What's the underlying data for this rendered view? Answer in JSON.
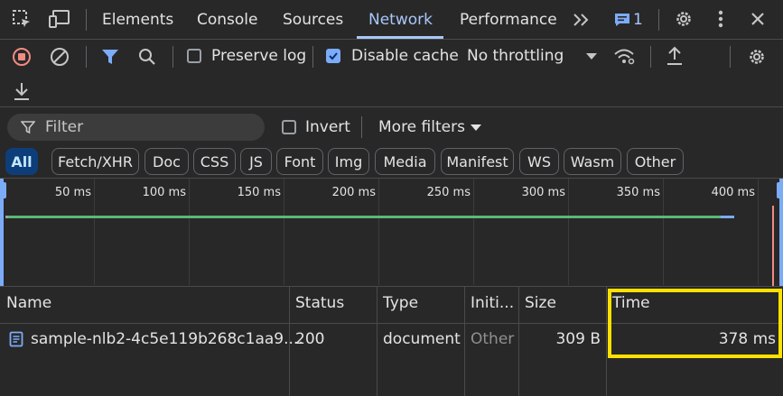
{
  "tabs": [
    {
      "label": "Elements"
    },
    {
      "label": "Console"
    },
    {
      "label": "Sources"
    },
    {
      "label": "Network",
      "active": true
    },
    {
      "label": "Performance"
    }
  ],
  "issues_count": "1",
  "toolbar": {
    "preserve_log": {
      "label": "Preserve log",
      "checked": false
    },
    "disable_cache": {
      "label": "Disable cache",
      "checked": true
    },
    "throttling": "No throttling"
  },
  "filter": {
    "placeholder": "Filter",
    "invert": {
      "label": "Invert",
      "checked": false
    },
    "more_filters": "More filters"
  },
  "type_filters": [
    {
      "label": "All",
      "active": true
    },
    {
      "label": "Fetch/XHR"
    },
    {
      "label": "Doc"
    },
    {
      "label": "CSS"
    },
    {
      "label": "JS"
    },
    {
      "label": "Font"
    },
    {
      "label": "Img"
    },
    {
      "label": "Media"
    },
    {
      "label": "Manifest"
    },
    {
      "label": "WS"
    },
    {
      "label": "Wasm"
    },
    {
      "label": "Other"
    }
  ],
  "timeline": {
    "ticks": [
      "50 ms",
      "100 ms",
      "150 ms",
      "200 ms",
      "250 ms",
      "300 ms",
      "350 ms",
      "400 ms"
    ]
  },
  "table": {
    "columns": [
      "Name",
      "Status",
      "Type",
      "Initi...",
      "Size",
      "Time"
    ],
    "rows": [
      {
        "name": "sample-nlb2-4c5e119b268c1aa9....",
        "status": "200",
        "type": "document",
        "initiator": "Other",
        "size": "309 B",
        "time": "378 ms"
      }
    ]
  },
  "colors": {
    "accent": "#a8c7fa",
    "highlight": "#ffe100",
    "record_stop": "#f28b82",
    "waterfall": "#5bb974"
  },
  "icons": [
    "element-picker-icon",
    "device-toolbar-icon",
    "more-tabs-icon",
    "issues-icon",
    "settings-icon",
    "kebab-menu-icon",
    "close-icon",
    "stop-recording-icon",
    "clear-icon",
    "filter-icon",
    "search-icon",
    "dropdown-icon",
    "network-conditions-icon",
    "upload-icon",
    "download-icon",
    "document-icon"
  ]
}
